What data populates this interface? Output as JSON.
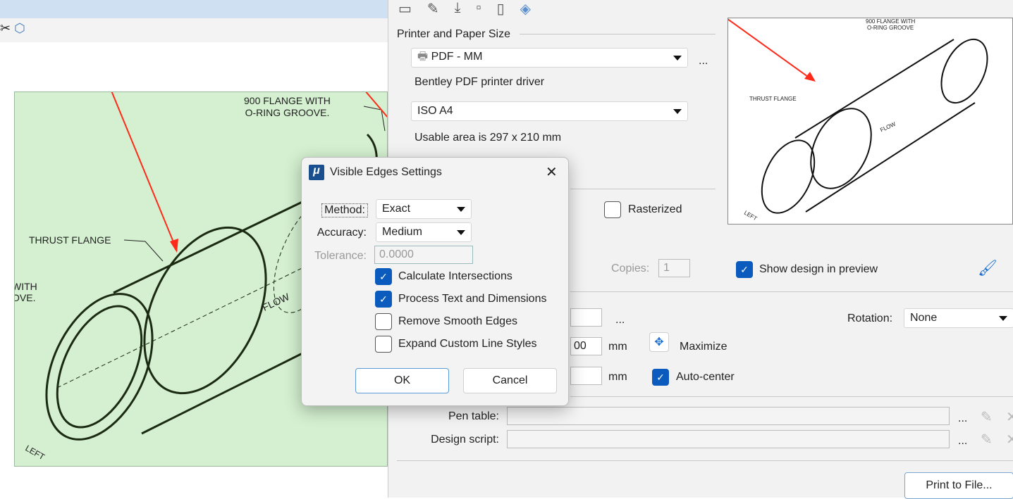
{
  "drawing": {
    "label_flange900_1": "900 FLANGE WITH",
    "label_flange900_2": "O-RING GROOVE.",
    "label_thrust": "THRUST FLANGE",
    "label_with_1": "WITH",
    "label_with_2": "OVE.",
    "label_flow": "FLOW",
    "label_left": "LEFT"
  },
  "print": {
    "section_printer": "Printer and Paper Size",
    "printer": "PDF - MM",
    "driver": "Bentley PDF printer driver",
    "paper": "ISO A4",
    "usable": "Usable area is 297 x 210 mm",
    "rasterized": "Rasterized",
    "copies_label": "Copies:",
    "copies": "1",
    "show_design": "Show design in preview",
    "rotation_label": "Rotation:",
    "rotation": "None",
    "width_value": "00",
    "unit1": "mm",
    "unit2": "mm",
    "maximize": "Maximize",
    "auto_center": "Auto-center",
    "pen_table": "Pen table:",
    "design_script": "Design script:",
    "ellipsis": "...",
    "print_to_file": "Print to File...",
    "preview_label_1": "900 FLANGE WITH",
    "preview_label_2": "O-RING GROOVE",
    "preview_thrust": "THRUST FLANGE",
    "preview_flow": "FLOW",
    "preview_left": "LEFT"
  },
  "dialog": {
    "title": "Visible Edges Settings",
    "method_label": "Method:",
    "method": "Exact",
    "accuracy_label": "Accuracy:",
    "accuracy": "Medium",
    "tolerance_label": "Tolerance:",
    "tolerance": "0.0000",
    "options": [
      {
        "label": "Calculate Intersections",
        "checked": true
      },
      {
        "label": "Process Text and Dimensions",
        "checked": true
      },
      {
        "label": "Remove Smooth Edges",
        "checked": false
      },
      {
        "label": "Expand Custom Line Styles",
        "checked": false
      }
    ],
    "ok": "OK",
    "cancel": "Cancel"
  },
  "colors": {
    "accent": "#0a5bbd",
    "canvas": "#d4f0d0",
    "arrow": "#ff2a1a"
  }
}
